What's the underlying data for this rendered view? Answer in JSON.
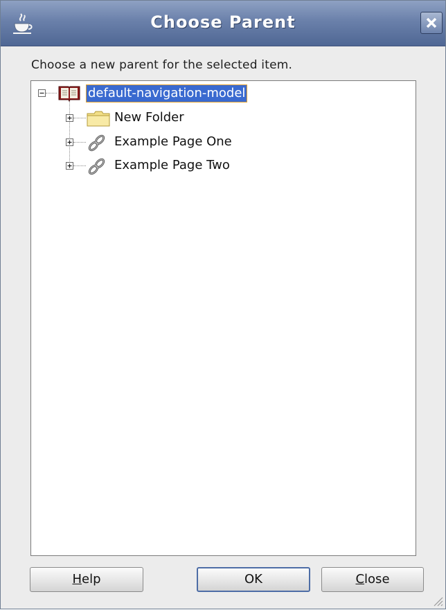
{
  "dialog": {
    "title": "Choose Parent",
    "title_icon": "java-cup-icon",
    "close_icon": "close-x-icon"
  },
  "description": "Choose a new parent for the selected item.",
  "tree": {
    "root": {
      "label": "default-navigation-model",
      "icon": "book-icon",
      "expanded": true,
      "selected": true
    },
    "children": [
      {
        "label": "New Folder",
        "icon": "folder-icon",
        "expanded": false
      },
      {
        "label": "Example Page One",
        "icon": "link-icon",
        "expanded": false
      },
      {
        "label": "Example Page Two",
        "icon": "link-icon",
        "expanded": false
      }
    ]
  },
  "buttons": {
    "help": {
      "mnemonic": "H",
      "rest": "elp"
    },
    "ok": {
      "label": "OK"
    },
    "close": {
      "mnemonic": "C",
      "rest": "lose"
    }
  },
  "colors": {
    "titlebar": "#6a80aa",
    "selection": "#3a6ad0",
    "selection_border": "#e0a030"
  }
}
